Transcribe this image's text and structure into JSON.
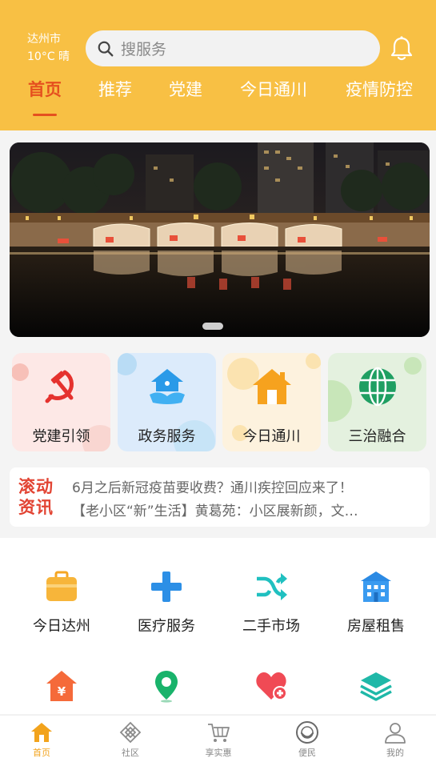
{
  "location": {
    "city": "达州市",
    "weather": "10°C  晴"
  },
  "search": {
    "placeholder": "搜服务"
  },
  "tabs": [
    {
      "label": "首页"
    },
    {
      "label": "推荐"
    },
    {
      "label": "党建"
    },
    {
      "label": "今日通川"
    },
    {
      "label": "疫情防控"
    }
  ],
  "categories": [
    {
      "label": "党建引领",
      "icon": "hammer-sickle-icon"
    },
    {
      "label": "政务服务",
      "icon": "house-hand-icon"
    },
    {
      "label": "今日通川",
      "icon": "home-icon"
    },
    {
      "label": "三治融合",
      "icon": "globe-icon"
    }
  ],
  "news": {
    "badge": "滚动资讯",
    "items": [
      "6月之后新冠疫苗要收费？通川疾控回应来了！",
      "【老小区“新”生活】黄葛苑：小区展新颜，文…"
    ]
  },
  "services": [
    {
      "label": "今日达州",
      "icon": "briefcase-icon"
    },
    {
      "label": "医疗服务",
      "icon": "medical-cross-icon"
    },
    {
      "label": "二手市场",
      "icon": "shuffle-icon"
    },
    {
      "label": "房屋租售",
      "icon": "building-icon"
    },
    {
      "label": "",
      "icon": "yuan-house-icon"
    },
    {
      "label": "",
      "icon": "map-pin-icon"
    },
    {
      "label": "",
      "icon": "heart-plus-icon"
    },
    {
      "label": "",
      "icon": "layers-icon"
    }
  ],
  "bottom_nav": [
    {
      "label": "首页",
      "icon": "home-icon"
    },
    {
      "label": "社区",
      "icon": "community-icon"
    },
    {
      "label": "享实惠",
      "icon": "cart-icon"
    },
    {
      "label": "便民",
      "icon": "smile-chat-icon"
    },
    {
      "label": "我的",
      "icon": "user-icon"
    }
  ],
  "colors": {
    "header": "#f8c044",
    "accent": "#e5501f",
    "nav_active": "#f2a31c"
  }
}
